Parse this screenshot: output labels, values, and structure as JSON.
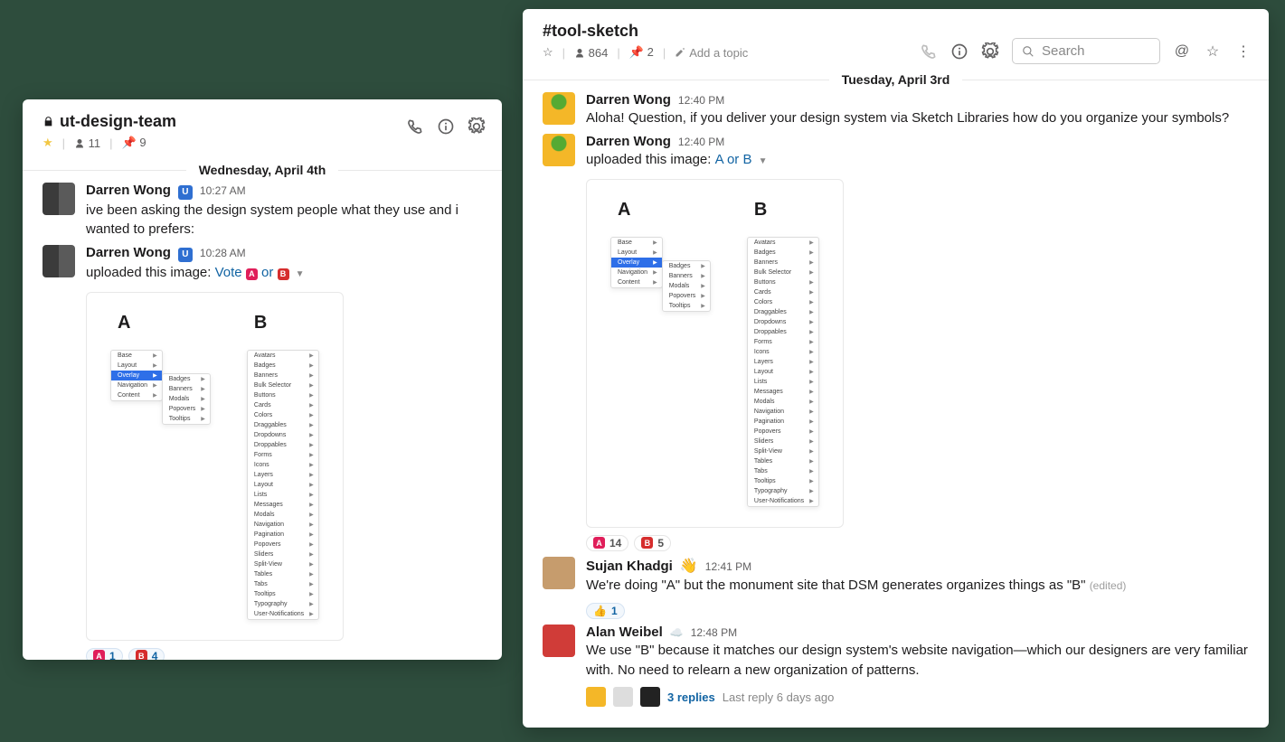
{
  "left": {
    "channel_name": "ut-design-team",
    "members": "11",
    "pins": "9",
    "date": "Wednesday, April 4th",
    "m1": {
      "name": "Darren Wong",
      "time": "10:27 AM",
      "body": "ive been asking the design system people what they use and i wanted to prefers:"
    },
    "m2": {
      "name": "Darren Wong",
      "time": "10:28 AM",
      "upload_prefix": "uploaded this image: ",
      "link_vote": "Vote",
      "link_or": " or "
    },
    "rx": {
      "a": "1",
      "b": "4"
    }
  },
  "right": {
    "channel_name": "#tool-sketch",
    "members": "864",
    "pins": "2",
    "topic": "Add a topic",
    "search_ph": "Search",
    "date": "Tuesday, April 3rd",
    "m1": {
      "name": "Darren Wong",
      "time": "12:40 PM",
      "body": "Aloha! Question, if you deliver your design system via Sketch Libraries how do you organize your symbols?"
    },
    "m2": {
      "name": "Darren Wong",
      "time": "12:40 PM",
      "upload_prefix": "uploaded this image: ",
      "link": "A or B"
    },
    "rx": {
      "a": "14",
      "b": "5"
    },
    "m3": {
      "name": "Sujan Khadgi",
      "time": "12:41 PM",
      "body": "We're doing \"A\" but the monument site that DSM generates organizes things as \"B\"",
      "edited": "(edited)",
      "thumb": "1"
    },
    "m4": {
      "name": "Alan Weibel",
      "time": "12:48 PM",
      "body": "We use \"B\" because it matches our design system's website navigation—which our designers are very familiar with. No need to relearn a new organization of patterns.",
      "replies": "3 replies",
      "last": "Last reply 6 days ago"
    }
  },
  "menuA_top": [
    "Base",
    "Layout",
    "Overlay",
    "Navigation",
    "Content"
  ],
  "menuA_sub": [
    "Badges",
    "Banners",
    "Modals",
    "Popovers",
    "Tooltips"
  ],
  "menuB": [
    "Avatars",
    "Badges",
    "Banners",
    "Bulk Selector",
    "Buttons",
    "Cards",
    "Colors",
    "Draggables",
    "Dropdowns",
    "Droppables",
    "Forms",
    "Icons",
    "Layers",
    "Layout",
    "Lists",
    "Messages",
    "Modals",
    "Navigation",
    "Pagination",
    "Popovers",
    "Sliders",
    "Split-View",
    "Tables",
    "Tabs",
    "Tooltips",
    "Typography",
    "User-Notifications"
  ]
}
